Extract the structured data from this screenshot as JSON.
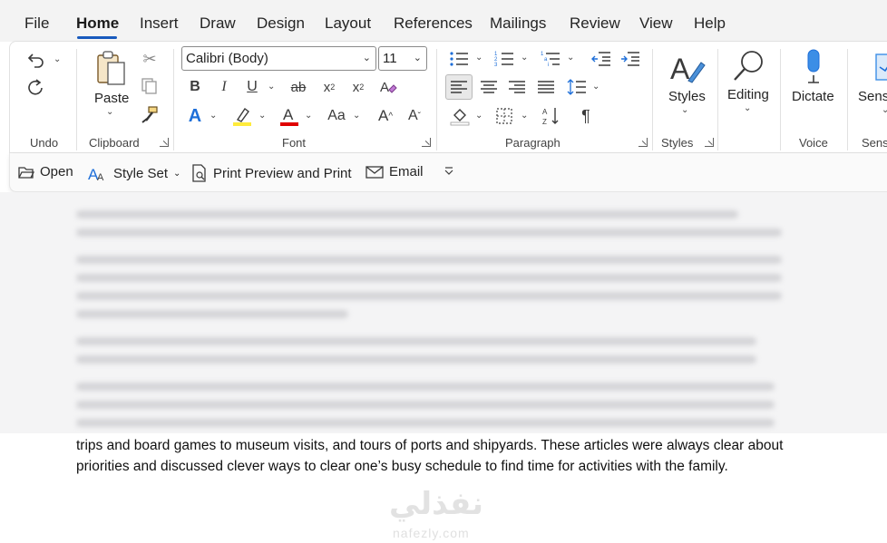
{
  "tabs": [
    "File",
    "Home",
    "Insert",
    "Draw",
    "Design",
    "Layout",
    "References",
    "Mailings",
    "Review",
    "View",
    "Help"
  ],
  "active_tab": "Home",
  "ribbon": {
    "undo": {
      "label": "Undo"
    },
    "clipboard": {
      "label": "Clipboard",
      "paste_label": "Paste"
    },
    "font": {
      "label": "Font",
      "font_name": "Calibri (Body)",
      "font_size": "11",
      "highlight_color": "#ffeb3b",
      "font_color": "#e00000"
    },
    "paragraph": {
      "label": "Paragraph"
    },
    "styles": {
      "label": "Styles",
      "styles_button": "Styles"
    },
    "editing": {
      "label": "Editing"
    },
    "voice": {
      "label": "Voice",
      "dictate_button": "Dictate"
    },
    "sensitivity": {
      "label": "Sens",
      "button": "Sensi"
    }
  },
  "qat": {
    "open": "Open",
    "style_set": "Style Set",
    "print_preview": "Print Preview and Print",
    "email": "Email"
  },
  "document": {
    "visible_text": "trips and board games to museum visits, and tours of ports and shipyards. These articles were always clear about priorities and discussed clever ways to clear one’s busy schedule to find time for activities with the family."
  },
  "watermark": {
    "arabic": "نفذلي",
    "latin": "nafezly.com"
  },
  "colors": {
    "accent": "#185abd",
    "ribbon_bg": "#ffffff",
    "tabbar_bg": "#f3f3f3"
  }
}
